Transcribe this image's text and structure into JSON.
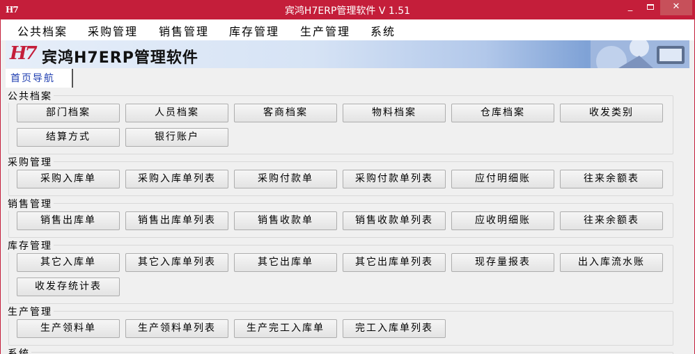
{
  "window": {
    "logo": "H7",
    "title": "宾鸿H7ERP管理软件 V 1.51",
    "minimize": "_",
    "close": "✕"
  },
  "menu": [
    "公共档案",
    "采购管理",
    "销售管理",
    "库存管理",
    "生产管理",
    "系统"
  ],
  "banner": {
    "logo": "H7",
    "title": "宾鸿H7ERP管理软件"
  },
  "tabs": [
    "首页导航"
  ],
  "groups": [
    {
      "title": "公共档案",
      "buttons": [
        "部门档案",
        "人员档案",
        "客商档案",
        "物料档案",
        "仓库档案",
        "收发类别",
        "结算方式",
        "银行账户"
      ]
    },
    {
      "title": "采购管理",
      "buttons": [
        "采购入库单",
        "采购入库单列表",
        "采购付款单",
        "采购付款单列表",
        "应付明细账",
        "往来余额表"
      ]
    },
    {
      "title": "销售管理",
      "buttons": [
        "销售出库单",
        "销售出库单列表",
        "销售收款单",
        "销售收款单列表",
        "应收明细账",
        "往来余额表"
      ]
    },
    {
      "title": "库存管理",
      "buttons": [
        "其它入库单",
        "其它入库单列表",
        "其它出库单",
        "其它出库单列表",
        "现存量报表",
        "出入库流水账",
        "收发存统计表"
      ]
    },
    {
      "title": "生产管理",
      "buttons": [
        "生产领料单",
        "生产领料单列表",
        "生产完工入库单",
        "完工入库单列表"
      ]
    },
    {
      "title": "系统",
      "buttons": []
    }
  ],
  "colors": {
    "titlebar": "#c41e3a",
    "tab_text": "#1e3db0",
    "banner_logo": "#c41e3a"
  }
}
